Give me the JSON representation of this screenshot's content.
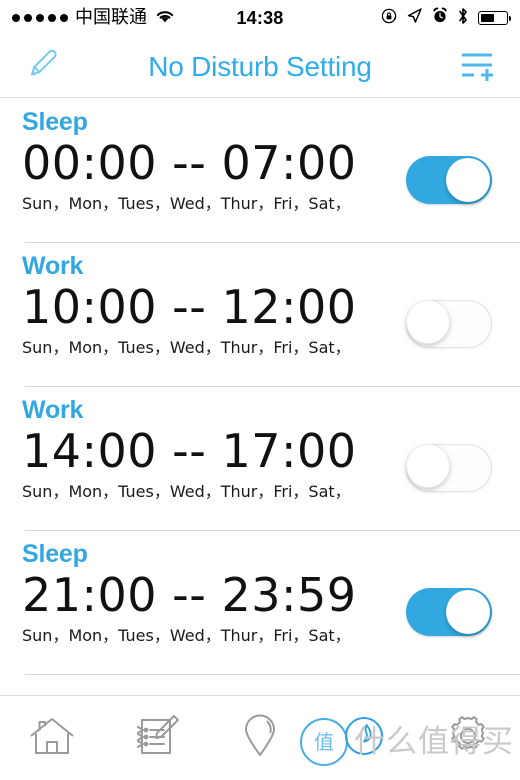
{
  "status_bar": {
    "signal_dots": 5,
    "carrier": "中国联通",
    "wifi_icon": "wifi-icon",
    "time": "14:38",
    "right_icons": [
      "rotation-lock-icon",
      "location-arrow-icon",
      "alarm-clock-icon",
      "bluetooth-icon",
      "battery-icon"
    ],
    "battery_percent": 50
  },
  "nav_bar": {
    "left_icon": "pencil-icon",
    "title": "No Disturb Setting",
    "right_icon": "add-list-icon",
    "accent_color": "#2facec"
  },
  "schedule": {
    "separator": "--",
    "rows": [
      {
        "label": "Sleep",
        "start": "00:00",
        "end": "07:00",
        "time": "00:00 -- 07:00",
        "days": "Sun，Mon，Tues，Wed，Thur，Fri，Sat，",
        "enabled": true,
        "toggle_state": "on"
      },
      {
        "label": "Work",
        "start": "10:00",
        "end": "12:00",
        "time": "10:00 -- 12:00",
        "days": "Sun，Mon，Tues，Wed，Thur，Fri，Sat，",
        "enabled": false,
        "toggle_state": "off"
      },
      {
        "label": "Work",
        "start": "14:00",
        "end": "17:00",
        "time": "14:00 -- 17:00",
        "days": "Sun，Mon，Tues，Wed，Thur，Fri，Sat，",
        "enabled": false,
        "toggle_state": "off"
      },
      {
        "label": "Sleep",
        "start": "21:00",
        "end": "23:59",
        "time": "21:00 -- 23:59",
        "days": "Sun，Mon，Tues，Wed，Thur，Fri，Sat，",
        "enabled": true,
        "toggle_state": "on"
      }
    ]
  },
  "tab_bar": {
    "tabs": [
      {
        "icon": "home-icon",
        "active": false
      },
      {
        "icon": "notepad-pen-icon",
        "active": false
      },
      {
        "icon": "location-pin-icon",
        "active": false
      },
      {
        "icon": "bell-circle-icon",
        "active": true
      },
      {
        "icon": "gear-icon",
        "active": false
      }
    ],
    "active_color": "#2f9fe0",
    "inactive_color": "#9a9a9a"
  },
  "watermark": {
    "logo_glyph": "值",
    "text": "什么值得买"
  }
}
